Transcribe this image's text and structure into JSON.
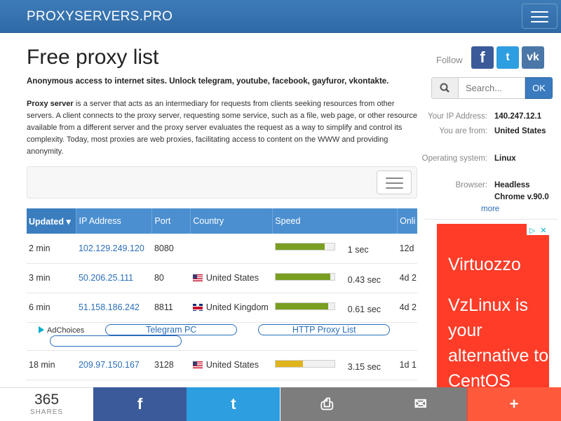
{
  "navbar": {
    "brand": "PROXYSERVERS.PRO"
  },
  "main": {
    "title": "Free proxy list",
    "lead": "Anonymous access to internet sites. Unlock telegram, youtube, facebook, gayfuror, vkontakte.",
    "intro_term": "Proxy server",
    "intro_text": " is a server that acts as an intermediary for requests from clients seeking resources from other servers. A client connects to the proxy server, requesting some service, such as a file, web page, or other resource available from a different server and the proxy server evaluates the request as a way to simplify and control its complexity. Today, most proxies are web proxies, facilitating access to content on the WWW and providing anonymity."
  },
  "table": {
    "headers": [
      "Updated ▾",
      "IP Address",
      "Port",
      "Country",
      "Speed",
      "Onli"
    ],
    "rows": [
      {
        "updated": "2 min",
        "ip": "102.129.249.120",
        "port": "8080",
        "country": "",
        "flag": "",
        "speed_fraction": 0.83,
        "speed_color": "#7a9e1f",
        "speed": "1 sec",
        "online": "12d"
      },
      {
        "updated": "3 min",
        "ip": "50.206.25.111",
        "port": "80",
        "country": "United States",
        "flag": "us",
        "speed_fraction": 0.93,
        "speed_color": "#7a9e1f",
        "speed": "0.43 sec",
        "online": "4d 2"
      },
      {
        "updated": "6 min",
        "ip": "51.158.186.242",
        "port": "8811",
        "country": "United Kingdom",
        "flag": "gb",
        "speed_fraction": 0.9,
        "speed_color": "#7a9e1f",
        "speed": "0.61 sec",
        "online": "4d 2"
      }
    ],
    "ad_row": {
      "adchoices": "AdChoices",
      "link1": "Telegram PC",
      "link2": "HTTP Proxy List"
    },
    "rows_after": [
      {
        "updated": "18 min",
        "ip": "209.97.150.167",
        "port": "3128",
        "country": "United States",
        "flag": "us",
        "speed_fraction": 0.47,
        "speed_color": "#e0b41c",
        "speed": "3.15 sec",
        "online": "1d 1"
      }
    ]
  },
  "sidebar": {
    "follow": "Follow",
    "social": [
      {
        "icon": "facebook-icon",
        "glyph": "f",
        "color": "#3b5a9a"
      },
      {
        "icon": "twitter-icon",
        "glyph": "t",
        "color": "#2d9ee0"
      },
      {
        "icon": "vk-icon",
        "glyph": "vk",
        "color": "#4a76a8"
      }
    ],
    "search_placeholder": "Search...",
    "search_button": "OK",
    "info": [
      {
        "key": "Your IP Address:",
        "value": "140.247.12.1"
      },
      {
        "key": "You are from:",
        "value": "United States"
      },
      {
        "key": "Operating system:",
        "value": "Linux"
      },
      {
        "key": "Browser:",
        "value": "Headless Chrome v.90.0"
      }
    ],
    "more": "more",
    "ad": {
      "brand": "Virtuozzo",
      "text": "VzLinux is your alternative to CentOS"
    }
  },
  "share_bar": {
    "count": "365",
    "label": "SHARES",
    "buttons": [
      {
        "icon": "facebook-icon",
        "glyph": "f",
        "color": "#3b5a9a"
      },
      {
        "icon": "twitter-icon",
        "glyph": "t",
        "color": "#2d9ee0"
      },
      {
        "icon": "print-icon",
        "glyph": "⎙",
        "color": "#7d7d7d"
      },
      {
        "icon": "email-icon",
        "glyph": "✉",
        "color": "#7d7d7d"
      },
      {
        "icon": "more-icon",
        "glyph": "+",
        "color": "#ff5a3c"
      }
    ]
  }
}
